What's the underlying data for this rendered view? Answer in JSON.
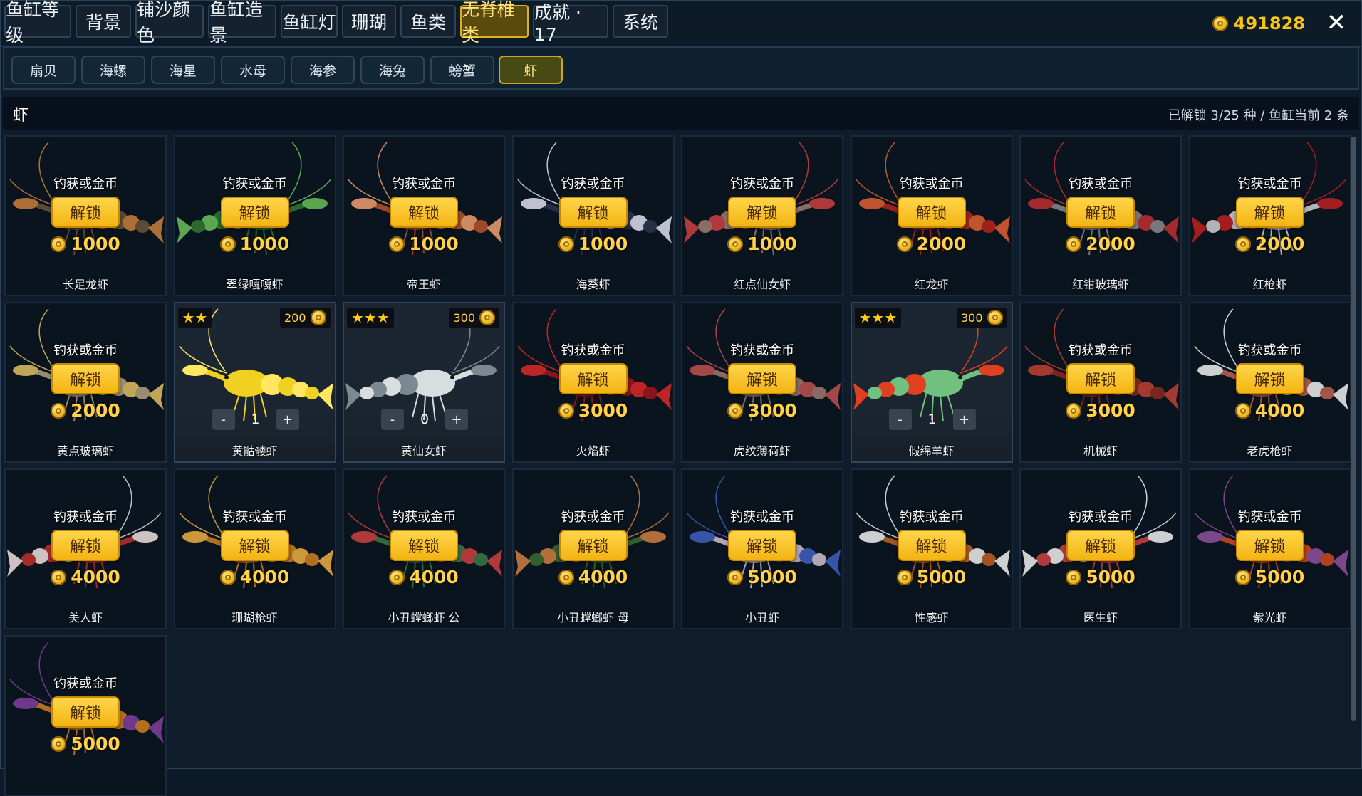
{
  "top_tabs": [
    {
      "id": "tank-level",
      "label": "鱼缸等级"
    },
    {
      "id": "background",
      "label": "背景"
    },
    {
      "id": "sand-color",
      "label": "铺沙颜色"
    },
    {
      "id": "tank-scenery",
      "label": "鱼缸造景"
    },
    {
      "id": "tank-light",
      "label": "鱼缸灯"
    },
    {
      "id": "coral",
      "label": "珊瑚"
    },
    {
      "id": "fish",
      "label": "鱼类"
    },
    {
      "id": "invertebrates",
      "label": "无脊椎类",
      "active": true
    },
    {
      "id": "achievements",
      "label": "成就 · 17"
    },
    {
      "id": "system",
      "label": "系统"
    }
  ],
  "coins": "491828",
  "close_symbol": "✕",
  "sub_tabs": [
    {
      "id": "scallop",
      "label": "扇贝"
    },
    {
      "id": "snail",
      "label": "海螺"
    },
    {
      "id": "starfish",
      "label": "海星"
    },
    {
      "id": "jellyfish",
      "label": "水母"
    },
    {
      "id": "sea-cucumber",
      "label": "海参"
    },
    {
      "id": "sea-hare",
      "label": "海兔"
    },
    {
      "id": "crab",
      "label": "螃蟹"
    },
    {
      "id": "shrimp",
      "label": "虾",
      "active": true
    }
  ],
  "section": {
    "title": "虾",
    "status": "已解锁 3/25 种 / 鱼缸当前 2 条"
  },
  "labels": {
    "obtain": "钓获或金币",
    "unlock": "解锁",
    "minus": "-",
    "plus": "+"
  },
  "shrimp": [
    {
      "name": "长足龙虾",
      "price": "1000",
      "color": "#6b5436",
      "accent": "#c9803a"
    },
    {
      "name": "翠绿嘎嘎虾",
      "price": "1000",
      "color": "#2f7a2c",
      "accent": "#6cc05a"
    },
    {
      "name": "帝王虾",
      "price": "1000",
      "color": "#b8532a",
      "accent": "#f0a070"
    },
    {
      "name": "海葵虾",
      "price": "1000",
      "color": "#2a3550",
      "accent": "#e0e0f0"
    },
    {
      "name": "红点仙女虾",
      "price": "1000",
      "color": "#a08070",
      "accent": "#d04040"
    },
    {
      "name": "红龙虾",
      "price": "2000",
      "color": "#b8241c",
      "accent": "#e06030"
    },
    {
      "name": "红钳玻璃虾",
      "price": "2000",
      "color": "#8a8a8a",
      "accent": "#c03030"
    },
    {
      "name": "红枪虾",
      "price": "2000",
      "color": "#d0d0d0",
      "accent": "#c02020"
    },
    {
      "name": "黄点玻璃虾",
      "price": "2000",
      "color": "#b0a080",
      "accent": "#e0c060"
    },
    {
      "name": "黄骷髅虾",
      "owned": true,
      "stars": "★★",
      "value": "200",
      "count": "1",
      "color": "#f0d020",
      "accent": "#ffe860"
    },
    {
      "name": "黄仙女虾",
      "owned": true,
      "stars": "★★★",
      "value": "300",
      "count": "0",
      "color": "#d8dde0",
      "accent": "#7a8a90"
    },
    {
      "name": "火焰虾",
      "price": "3000",
      "color": "#a0141a",
      "accent": "#e02828"
    },
    {
      "name": "虎纹薄荷虾",
      "price": "3000",
      "color": "#a07870",
      "accent": "#c05050"
    },
    {
      "name": "假绵羊虾",
      "owned": true,
      "stars": "★★★",
      "value": "300",
      "count": "1",
      "color": "#70c080",
      "accent": "#e04020"
    },
    {
      "name": "机械虾",
      "price": "3000",
      "color": "#8a2a20",
      "accent": "#c04030"
    },
    {
      "name": "老虎枪虾",
      "price": "4000",
      "color": "#c06050",
      "accent": "#f0f0f0"
    },
    {
      "name": "美人虾",
      "price": "4000",
      "color": "#c03030",
      "accent": "#f0e0e0"
    },
    {
      "name": "珊瑚枪虾",
      "price": "4000",
      "color": "#d08020",
      "accent": "#f0b040"
    },
    {
      "name": "小丑螳螂虾 公",
      "price": "4000",
      "color": "#3a7a40",
      "accent": "#d04040"
    },
    {
      "name": "小丑螳螂虾 母",
      "price": "4000",
      "color": "#3a6a30",
      "accent": "#d08040"
    },
    {
      "name": "小丑虾",
      "price": "5000",
      "color": "#d0c0d0",
      "accent": "#4060c0"
    },
    {
      "name": "性感虾",
      "price": "5000",
      "color": "#c06020",
      "accent": "#f0f0f0"
    },
    {
      "name": "医生虾",
      "price": "5000",
      "color": "#d04040",
      "accent": "#f0f0f0"
    },
    {
      "name": "紫光虾",
      "price": "5000",
      "color": "#d04a20",
      "accent": "#9050a0"
    },
    {
      "name": "",
      "price": "5000",
      "color": "#d08020",
      "accent": "#8040a0"
    }
  ]
}
